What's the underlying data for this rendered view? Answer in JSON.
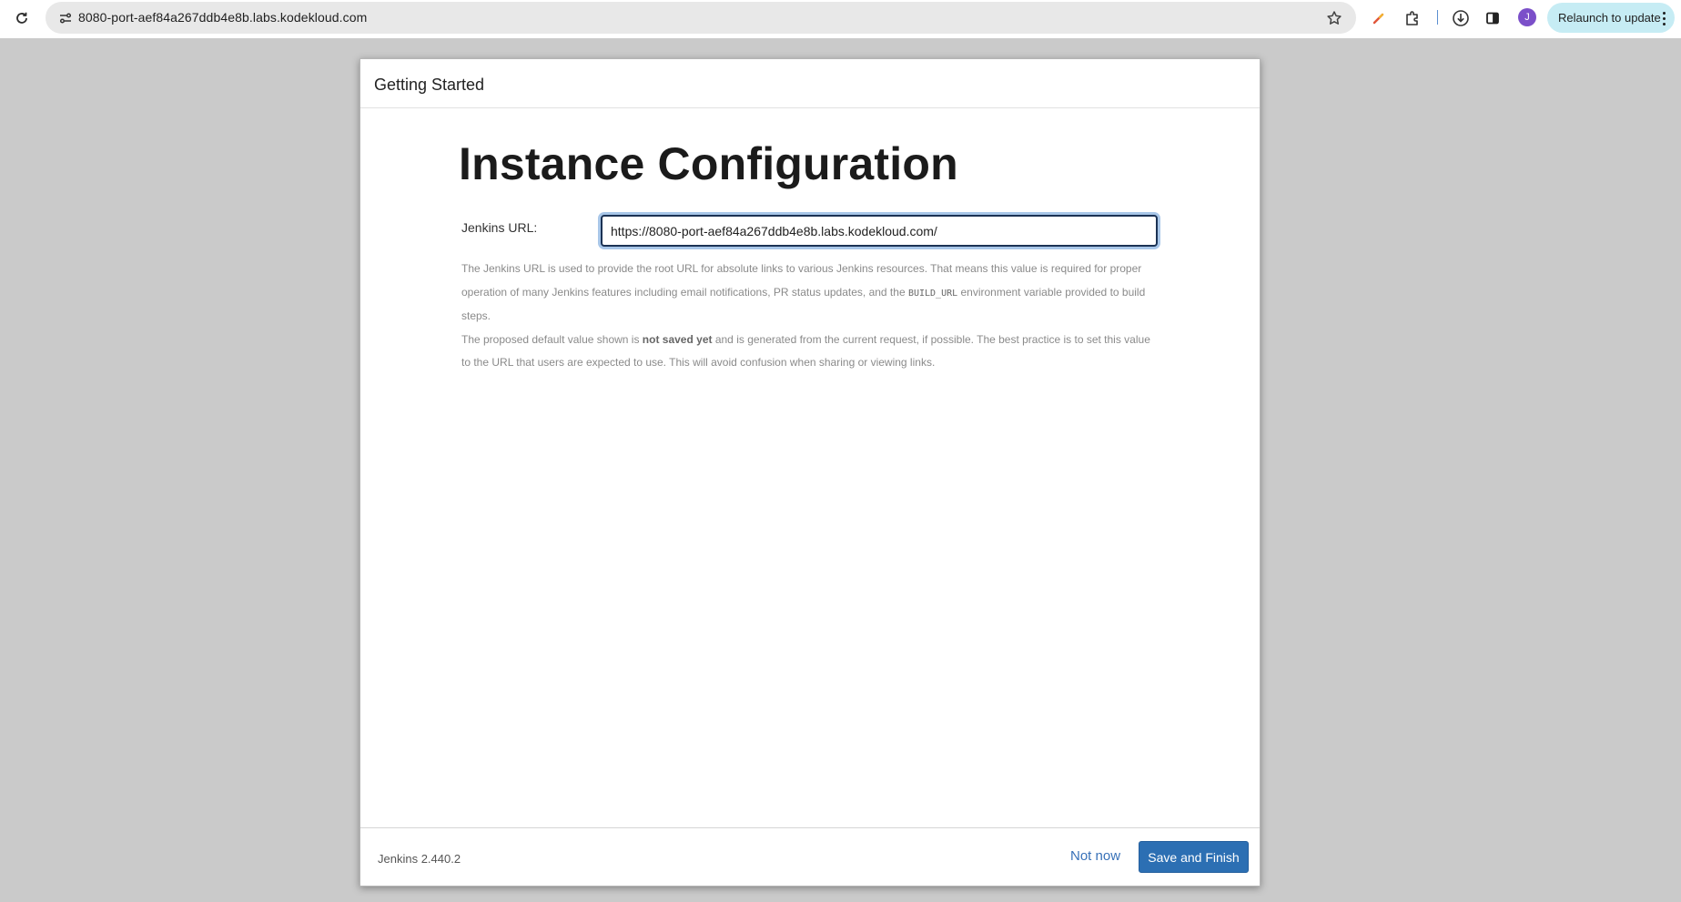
{
  "browser": {
    "address_bar": {
      "url": "8080-port-aef84a267ddb4e8b.labs.kodekloud.com"
    },
    "profile_initial": "J",
    "relaunch_label": "Relaunch to update",
    "icons": [
      "reload-icon",
      "site-info-icon",
      "star-icon",
      "color-picker-icon",
      "extensions-icon",
      "download-icon",
      "side-panel-icon",
      "more-menu-icon"
    ]
  },
  "dialog": {
    "header_title": "Getting Started",
    "heading": "Instance Configuration",
    "url_field": {
      "label": "Jenkins URL:",
      "value": "https://8080-port-aef84a267ddb4e8b.labs.kodekloud.com/"
    },
    "help": {
      "p1_before": "The Jenkins URL is used to provide the root URL for absolute links to various Jenkins resources. That means this value is required for proper operation of many Jenkins features including email notifications, PR status updates, and the ",
      "p1_code": "BUILD_URL",
      "p1_after": " environment variable provided to build steps.",
      "p2_before": "The proposed default value shown is ",
      "p2_bold": "not saved yet",
      "p2_after": " and is generated from the current request, if possible. The best practice is to set this value to the URL that users are expected to use. This will avoid confusion when sharing or viewing links."
    },
    "footer": {
      "version": "Jenkins 2.440.2",
      "not_now_label": "Not now",
      "save_label": "Save and Finish"
    }
  },
  "colors": {
    "primary_button": "#2c6fb3",
    "link": "#3871b8",
    "page_background": "#cacaca"
  }
}
